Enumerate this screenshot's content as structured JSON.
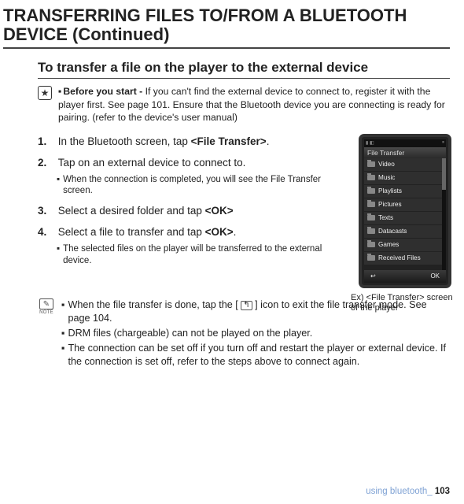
{
  "heading": "TRANSFERRING FILES TO/FROM A BLUETOOTH DEVICE (Continued)",
  "subheading": "To transfer a file on the player to the external device",
  "before": {
    "label": "Before you start -",
    "text": "If you can't find the external device to connect to, register it with the player first. See page 101. Ensure that the Bluetooth device you are connecting is ready for pairing. (refer to the device's user manual)"
  },
  "steps": [
    {
      "num": "1.",
      "text_pre": "In the Bluetooth screen, tap ",
      "bold": "<File Transfer>",
      "text_post": ".",
      "sub": []
    },
    {
      "num": "2.",
      "text_pre": "Tap on an external device to connect to.",
      "bold": "",
      "text_post": "",
      "sub": [
        "When the connection is completed, you will see the File Transfer screen."
      ]
    },
    {
      "num": "3.",
      "text_pre": "Select a desired folder and tap ",
      "bold": "<OK>",
      "text_post": "",
      "sub": []
    },
    {
      "num": "4.",
      "text_pre": "Select a file to transfer and tap ",
      "bold": "<OK>",
      "text_post": ".",
      "sub": [
        "The selected files on the player will be transferred to the external device."
      ]
    }
  ],
  "device": {
    "title": "File Transfer",
    "items": [
      "Video",
      "Music",
      "Playlists",
      "Pictures",
      "Texts",
      "Datacasts",
      "Games",
      "Received Files"
    ],
    "back": "↩",
    "ok": "OK"
  },
  "caption": "Ex) <File Transfer> screen of the player",
  "notes": {
    "iconlabel": "NOTE",
    "items": [
      {
        "pre": "When the file transfer is done, tap the [ ",
        "glyph": "↰",
        "post": " ] icon to exit the file transfer mode. See page 104."
      },
      {
        "pre": "DRM files (chargeable) can not be played on the player.",
        "glyph": "",
        "post": ""
      },
      {
        "pre": "The connection can be set off if you turn off and restart the player or external device. If the connection is set off, refer to the steps above to connect again.",
        "glyph": "",
        "post": ""
      }
    ]
  },
  "footer": {
    "text": "using bluetooth_ ",
    "page": "103"
  }
}
